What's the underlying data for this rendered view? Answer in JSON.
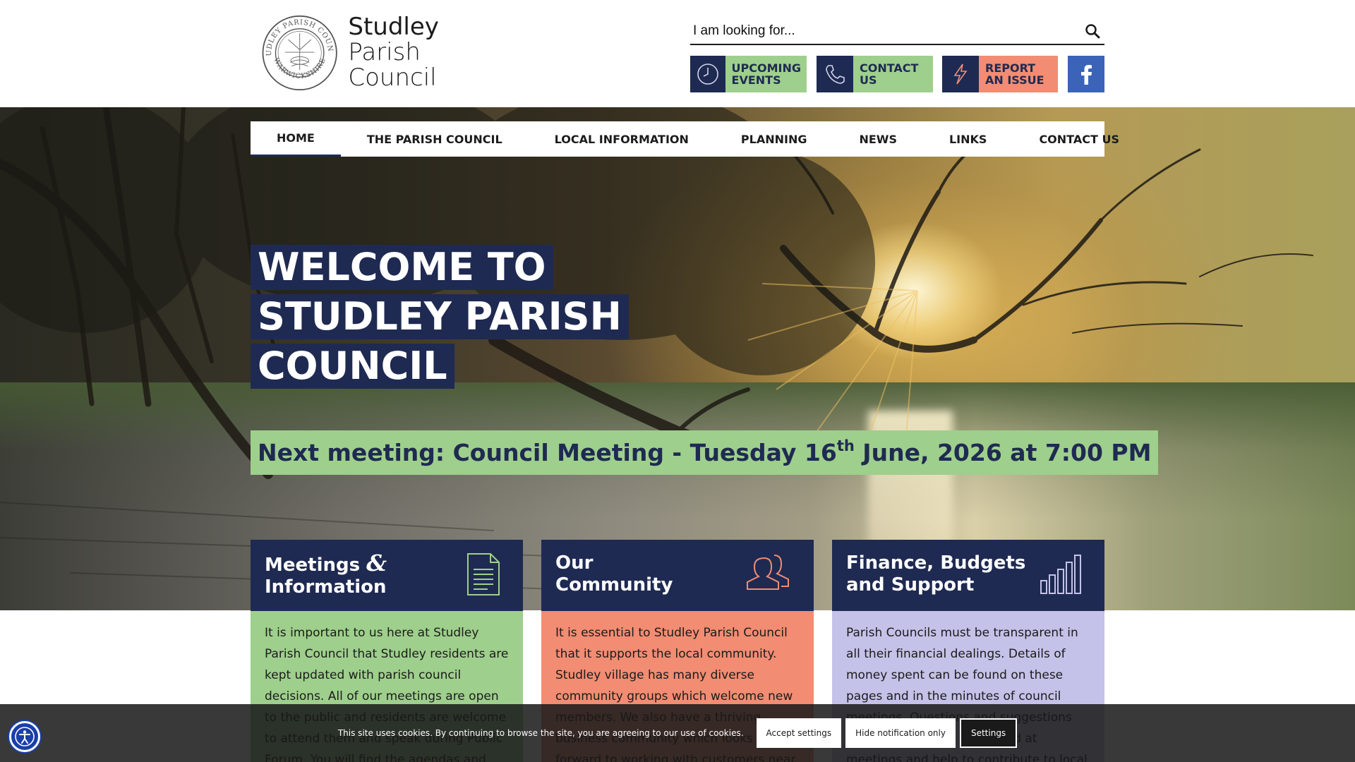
{
  "site": {
    "logo_line1": "Studley",
    "logo_line2": "Parish Council",
    "seal_text_top": "STUDLEY PARISH COUNCIL",
    "seal_text_bottom": "WARWICKSHIRE"
  },
  "search": {
    "placeholder": "I am looking for...",
    "icon": "search-icon"
  },
  "quick_links": [
    {
      "label": "UPCOMING EVENTS",
      "icon": "clock-icon",
      "color": "#9ecf8c"
    },
    {
      "label": "CONTACT US",
      "icon": "phone-icon",
      "color": "#9ecf8c"
    },
    {
      "label": "REPORT AN ISSUE",
      "icon": "lightning-icon",
      "color": "#f28c72"
    }
  ],
  "facebook": {
    "icon": "facebook-icon",
    "color": "#3b63b8"
  },
  "nav": [
    {
      "label": "HOME",
      "active": true
    },
    {
      "label": "THE PARISH COUNCIL",
      "active": false
    },
    {
      "label": "LOCAL INFORMATION",
      "active": false
    },
    {
      "label": "PLANNING",
      "active": false
    },
    {
      "label": "NEWS",
      "active": false
    },
    {
      "label": "LINKS",
      "active": false
    },
    {
      "label": "CONTACT US",
      "active": false
    }
  ],
  "hero": {
    "welcome_lines": [
      "WELCOME TO",
      "STUDLEY PARISH",
      "COUNCIL"
    ],
    "meeting_prefix": "Next meeting: Council Meeting - Tuesday 16",
    "meeting_sup": "th",
    "meeting_suffix": " June, 2026 at 7:00 PM"
  },
  "cards": [
    {
      "title_a": "Meetings",
      "title_amp": "&",
      "title_b": "Information",
      "icon": "document-icon",
      "body": "It is important to us here at Studley Parish Council that Studley residents are kept updated with parish council decisions. All of our meetings are open to the public and residents are welcome to attend them and speak during Public Forum. You will find the agendas and the minutes for all our meetings"
    },
    {
      "title_a": "Our",
      "title_amp": "",
      "title_b": "Community",
      "icon": "people-icon",
      "body": "It is essential to Studley Parish Council that it supports the local community. Studley village has many diverse community groups which welcome new members. We also have a thriving business community which looks forward to working with customers near and far."
    },
    {
      "title_a": "Finance, Budgets",
      "title_amp": "",
      "title_b": "and Support",
      "icon": "bar-chart-icon",
      "body": "Parish Councils must be transparent in all their financial dealings. Details of money spent can be found on these pages and in the minutes of council meetings. Questions and suggestions from residents are welcomed at meetings and help to contribute to local decision making and increase our democratic"
    }
  ],
  "cookie": {
    "text": "This site uses cookies. By continuing to browse the site, you are agreeing to our use of cookies.",
    "accept": "Accept settings",
    "hide": "Hide notification only",
    "settings": "Settings"
  },
  "accessibility": {
    "icon": "accessibility-icon"
  },
  "colors": {
    "navy": "#1f2a52",
    "green": "#9ecf8c",
    "coral": "#f28c72",
    "lavender": "#c4c2e8"
  }
}
